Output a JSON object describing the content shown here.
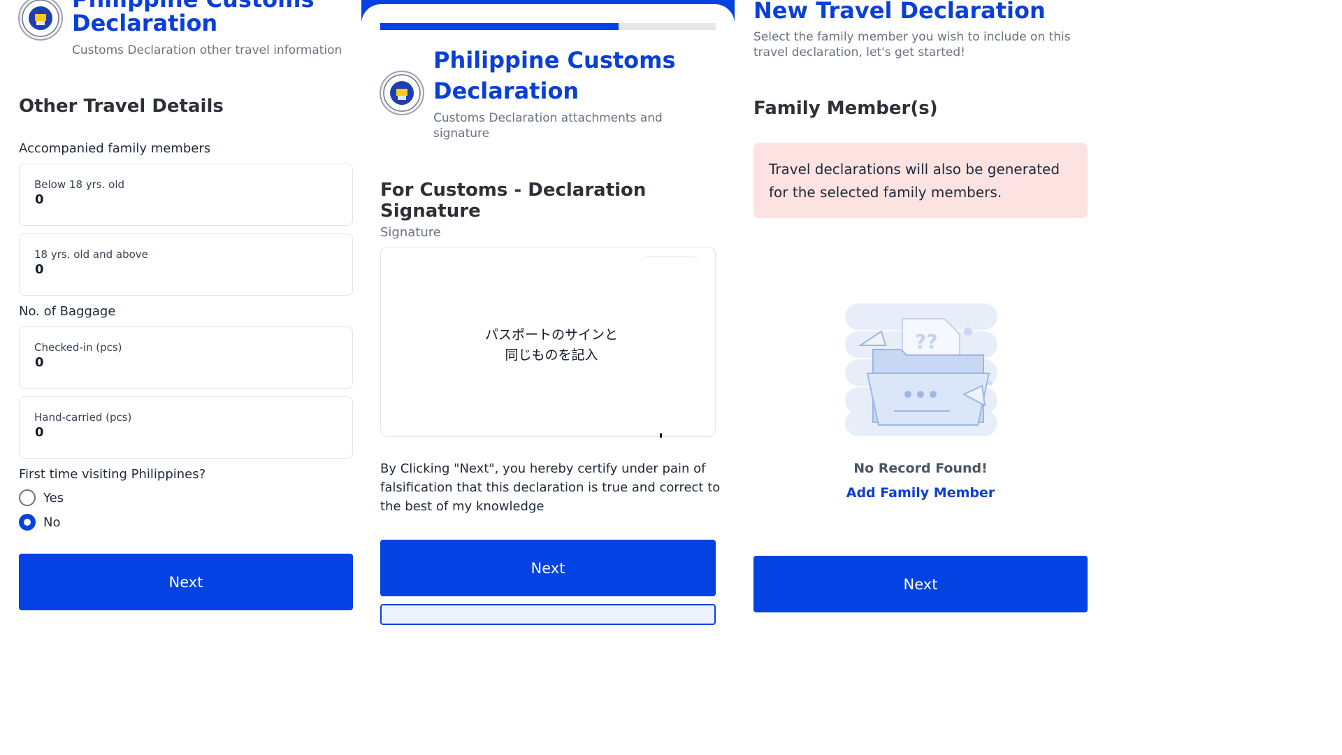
{
  "panel1": {
    "title_line1": "Philippine Customs",
    "title_line2": "Declaration",
    "subtitle": "Customs Declaration other travel information",
    "section_heading": "Other Travel Details",
    "family_label": "Accompanied family members",
    "below18_label": "Below 18 yrs. old",
    "below18_value": "0",
    "above18_label": "18 yrs. old and above",
    "above18_value": "0",
    "baggage_label": "No. of Baggage",
    "checked_label": "Checked-in (pcs)",
    "checked_value": "0",
    "hand_label": "Hand-carried (pcs)",
    "hand_value": "0",
    "first_time_question": "First time visiting Philippines?",
    "option_yes": "Yes",
    "option_no": "No",
    "selected_option": "No",
    "next_label": "Next"
  },
  "panel2": {
    "progress": 0.71,
    "title_line1": "Philippine Customs",
    "title_line2": "Declaration",
    "subtitle_line1": "Customs Declaration attachments and",
    "subtitle_line2": "signature",
    "section_heading": "For Customs - Declaration Signature",
    "signature_label": "Signature",
    "signature_hint_line1": "パスポートのサインと",
    "signature_hint_line2": "同じものを記入",
    "certify_line1": "By Clicking \"Next\", you hereby certify under pain of",
    "certify_line2": "falsification that this declaration is true and correct to",
    "certify_line3": "the best of my knowledge",
    "next_label": "Next"
  },
  "panel3": {
    "title": "New Travel Declaration",
    "subtitle_line1": "Select the family member you wish to include on this",
    "subtitle_line2": "travel declaration, let's get started!",
    "section_heading": "Family Member(s)",
    "notice_line1": "Travel declarations will also be generated",
    "notice_line2": "for the selected family members.",
    "empty_title": "No Record Found!",
    "add_link": "Add Family Member",
    "next_label": "Next"
  },
  "colors": {
    "brand_blue": "#0442e3",
    "title_blue": "#0a3fd8",
    "notice_bg": "#fde2e2",
    "progress_track": "#e5e7eb"
  },
  "icons": [
    "customs-seal-icon",
    "radio-unchecked-icon",
    "radio-checked-icon",
    "empty-folder-illustration"
  ]
}
